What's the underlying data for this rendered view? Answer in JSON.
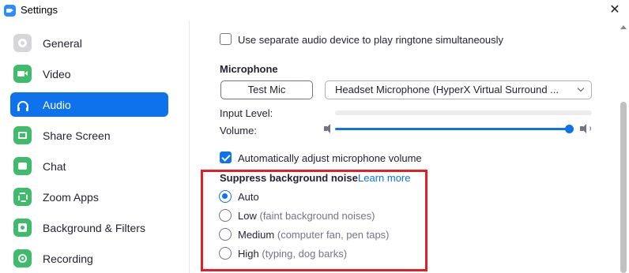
{
  "window": {
    "title": "Settings",
    "close_glyph": "✕"
  },
  "sidebar": {
    "items": [
      {
        "label": "General",
        "icon": "gear-icon"
      },
      {
        "label": "Video",
        "icon": "video-icon"
      },
      {
        "label": "Audio",
        "icon": "headphones-icon",
        "active": true
      },
      {
        "label": "Share Screen",
        "icon": "share-screen-icon"
      },
      {
        "label": "Chat",
        "icon": "chat-icon"
      },
      {
        "label": "Zoom Apps",
        "icon": "zoom-apps-icon"
      },
      {
        "label": "Background & Filters",
        "icon": "background-icon"
      },
      {
        "label": "Recording",
        "icon": "recording-icon"
      }
    ]
  },
  "audio": {
    "ringtone_checkbox_label": "Use separate audio device to play ringtone simultaneously",
    "ringtone_checked": false,
    "microphone": {
      "heading": "Microphone",
      "test_button": "Test Mic",
      "device_selected": "Headset Microphone (HyperX Virtual Surround ...",
      "input_level_label": "Input Level:",
      "volume_label": "Volume:",
      "volume_value": 1.0,
      "auto_adjust_label": "Automatically adjust microphone volume",
      "auto_adjust_checked": true
    },
    "noise": {
      "heading": "Suppress background noise",
      "learn_more": "Learn more",
      "options": [
        {
          "label": "Auto",
          "hint": "",
          "selected": true
        },
        {
          "label": "Low",
          "hint": "(faint background noises)",
          "selected": false
        },
        {
          "label": "Medium",
          "hint": "(computer fan, pen taps)",
          "selected": false
        },
        {
          "label": "High",
          "hint": "(typing, dog barks)",
          "selected": false
        }
      ]
    }
  },
  "colors": {
    "accent": "#0E72ED",
    "highlight_box": "#E31E24",
    "icon_green": "#3EBB6B"
  }
}
